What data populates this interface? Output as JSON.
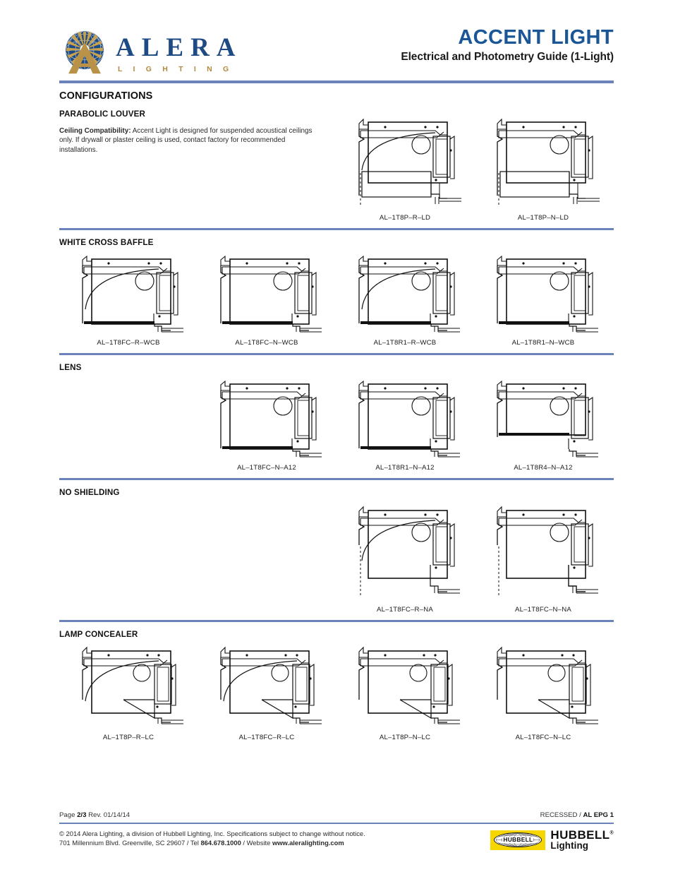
{
  "header": {
    "brand_name": "ALERA",
    "brand_sub": "L I G H T I N G",
    "title": "ACCENT LIGHT",
    "subtitle": "Electrical and Photometry Guide (1-Light)"
  },
  "page_heading": "CONFIGURATIONS",
  "sections": [
    {
      "name": "PARABOLIC LOUVER",
      "note_label": "Ceiling Compatibility:",
      "note_text": " Accent Light is designed for suspended acoustical ceilings only. If drywall or plaster ceiling is used, contact factory for recommended installations.",
      "items": [
        {
          "slot": 2,
          "label": "AL–1T8P–R–LD",
          "variant": "parabolic-reflector"
        },
        {
          "slot": 3,
          "label": "AL–1T8P–N–LD",
          "variant": "parabolic-nonreflector"
        }
      ]
    },
    {
      "name": "WHITE CROSS BAFFLE",
      "items": [
        {
          "slot": 0,
          "label": "AL–1T8FC–R–WCB",
          "variant": "baffle-reflector"
        },
        {
          "slot": 1,
          "label": "AL–1T8FC–N–WCB",
          "variant": "baffle-nonreflector"
        },
        {
          "slot": 2,
          "label": "AL–1T8R1–R–WCB",
          "variant": "baffle-reflector"
        },
        {
          "slot": 3,
          "label": "AL–1T8R1–N–WCB",
          "variant": "baffle-nonreflector"
        }
      ]
    },
    {
      "name": "LENS",
      "items": [
        {
          "slot": 1,
          "label": "AL–1T8FC–N–A12",
          "variant": "lens-low"
        },
        {
          "slot": 2,
          "label": "AL–1T8R1–N–A12",
          "variant": "lens-low"
        },
        {
          "slot": 3,
          "label": "AL–1T8R4–N–A12",
          "variant": "lens-high"
        }
      ]
    },
    {
      "name": "NO SHIELDING",
      "items": [
        {
          "slot": 2,
          "label": "AL–1T8FC–R–NA",
          "variant": "open-reflector"
        },
        {
          "slot": 3,
          "label": "AL–1T8FC–N–NA",
          "variant": "open-nonreflector"
        }
      ]
    },
    {
      "name": "LAMP CONCEALER",
      "items": [
        {
          "slot": 0,
          "label": "AL–1T8P–R–LC",
          "variant": "concealer-reflector"
        },
        {
          "slot": 1,
          "label": "AL–1T8FC–R–LC",
          "variant": "concealer-reflector"
        },
        {
          "slot": 2,
          "label": "AL–1T8P–N–LC",
          "variant": "concealer-nonreflector"
        },
        {
          "slot": 3,
          "label": "AL–1T8FC–N–LC",
          "variant": "concealer-nonreflector"
        }
      ]
    }
  ],
  "footer": {
    "page_prefix": "Page ",
    "page_number": "2/3",
    "revision": " Rev. 01/14/14",
    "doc_ref_prefix": "RECESSED / ",
    "doc_ref_code": "AL EPG 1",
    "legal_line1": "© 2014 Alera Lighting, a division of Hubbell Lighting, Inc. Specifications subject to change without notice.",
    "legal_addr": "701 Millennium Blvd. Greenville, SC 29607 / Tel ",
    "legal_phone": "864.678.1000",
    "legal_mid": " / Website ",
    "legal_web": "www.aleralighting.com",
    "hubbell_badge": "HUBBELL",
    "hubbell_name": "HUBBELL",
    "hubbell_sub": "Lighting"
  },
  "colors": {
    "brand_blue": "#1b5697",
    "rule_blue": "#6b83b8",
    "gold": "#b08a3e",
    "navy": "#1f4b84",
    "hubbell_yellow": "#f5d600"
  }
}
